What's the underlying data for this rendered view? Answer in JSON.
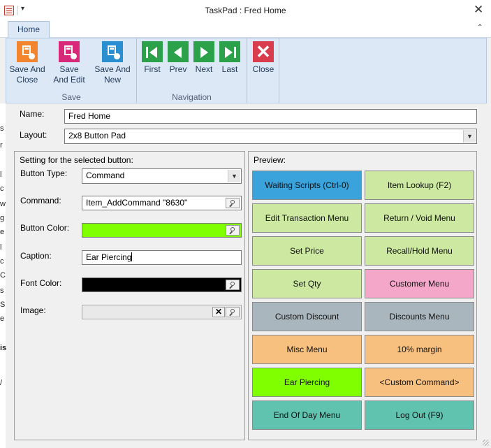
{
  "window": {
    "title": "TaskPad : Fred Home",
    "qa_menu_glyph": "▾",
    "close_glyph": "✕"
  },
  "ribbon_tabs": [
    {
      "label": "Home"
    }
  ],
  "collapse_glyph": "⌃",
  "ribbon": {
    "save_group": {
      "label": "Save",
      "save_and_close": "Save And\nClose",
      "save_and_edit": "Save\nAnd Edit",
      "save_and_new": "Save And\nNew"
    },
    "navigation_group": {
      "label": "Navigation",
      "first": "First",
      "prev": "Prev",
      "next": "Next",
      "last": "Last"
    },
    "close_group": {
      "close": "Close",
      "close_glyph": "✕"
    }
  },
  "background_strip": [
    "s",
    "r",
    "l",
    "c",
    "w",
    "g",
    "e",
    "l",
    "c",
    "C",
    "s",
    "S",
    "e",
    "is",
    "/"
  ],
  "form": {
    "name_label": "Name:",
    "name_value": "Fred Home",
    "layout_label": "Layout:",
    "layout_value": "2x8 Button Pad"
  },
  "settings": {
    "title": "Setting for the selected button:",
    "button_type_label": "Button Type:",
    "button_type_value": "Command",
    "command_label": "Command:",
    "command_value": "Item_AddCommand \"8630\"",
    "button_color_label": "Button Color:",
    "button_color": "#80ff00",
    "caption_label": "Caption:",
    "caption_value": "Ear Piercing",
    "font_color_label": "Font Color:",
    "font_color": "#000000",
    "image_label": "Image:",
    "clear_glyph": "✕"
  },
  "preview": {
    "title": "Preview:",
    "buttons": [
      {
        "caption": "Waiting Scripts (Ctrl-0)",
        "color": "#3aa3dc"
      },
      {
        "caption": "Item Lookup (F2)",
        "color": "#cde9a1"
      },
      {
        "caption": "Edit Transaction Menu",
        "color": "#cde9a1"
      },
      {
        "caption": "Return / Void Menu",
        "color": "#cde9a1"
      },
      {
        "caption": "Set Price",
        "color": "#cde9a1"
      },
      {
        "caption": "Recall/Hold Menu",
        "color": "#cde9a1"
      },
      {
        "caption": "Set Qty",
        "color": "#cde9a1"
      },
      {
        "caption": "Customer Menu",
        "color": "#f4a7c9"
      },
      {
        "caption": "Custom Discount",
        "color": "#a9b6bd"
      },
      {
        "caption": "Discounts Menu",
        "color": "#a9b6bd"
      },
      {
        "caption": "Misc Menu",
        "color": "#f8c07f"
      },
      {
        "caption": "10% margin",
        "color": "#f8c07f"
      },
      {
        "caption": "Ear Piercing",
        "color": "#80ff00"
      },
      {
        "caption": "<Custom Command>",
        "color": "#f8c07f"
      },
      {
        "caption": "End Of Day Menu",
        "color": "#5fc3b0"
      },
      {
        "caption": "Log Out (F9)",
        "color": "#5fc3b0"
      }
    ]
  }
}
